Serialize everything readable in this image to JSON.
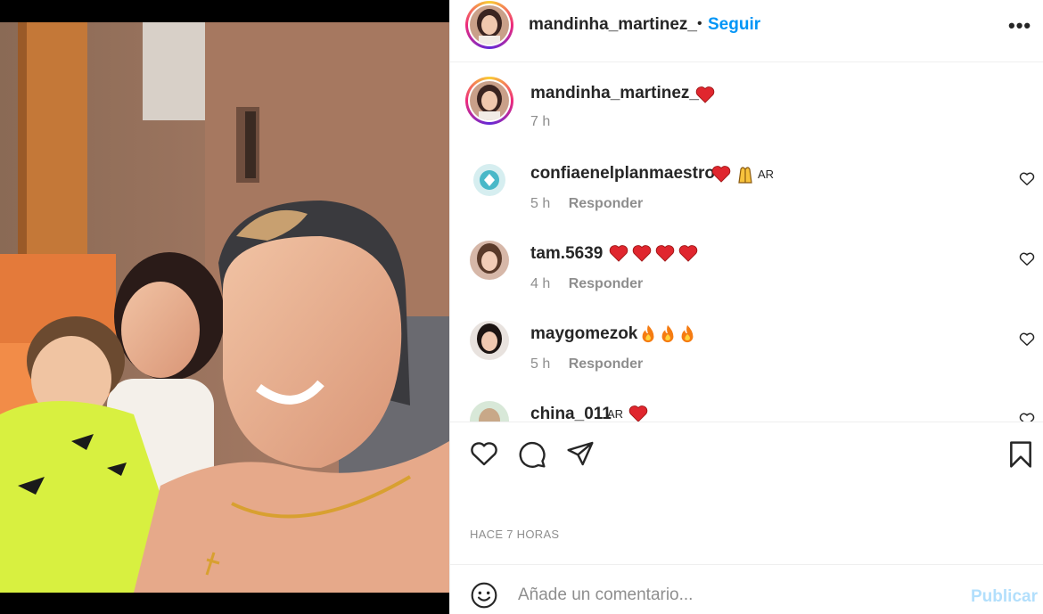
{
  "post": {
    "author": "mandinha_martinez_",
    "follow_label": "Seguir",
    "separator": "•",
    "more_label": "•••"
  },
  "caption": {
    "username": "mandinha_martinez_",
    "time": "7 h"
  },
  "comments": [
    {
      "username": "confiaenelplanmaestro",
      "time": "5 h",
      "reply_label": "Responder",
      "emoji": [
        "heart",
        "pray"
      ],
      "flag": "AR"
    },
    {
      "username": "tam.5639",
      "time": "4 h",
      "reply_label": "Responder",
      "emoji": [
        "heart",
        "heart",
        "heart",
        "heart"
      ]
    },
    {
      "username": "maygomezok",
      "time": "5 h",
      "reply_label": "Responder",
      "emoji": [
        "fire",
        "fire",
        "fire"
      ]
    },
    {
      "username": "china_011",
      "flag": "AR",
      "emoji": [
        "heart"
      ]
    }
  ],
  "actions": {
    "time_ago": "HACE 7 HORAS"
  },
  "composer": {
    "placeholder": "Añade un comentario...",
    "publish_label": "Publicar"
  },
  "colors": {
    "accent": "#0095f6",
    "publish_disabled": "#b2dffc",
    "muted": "#8e8e8e",
    "heart": "#ed4956"
  },
  "icons": [
    "more-options-icon",
    "heart-emoji",
    "pray-emoji",
    "fire-emoji",
    "like-icon",
    "comment-icon",
    "share-icon",
    "save-icon",
    "emoji-icon"
  ]
}
